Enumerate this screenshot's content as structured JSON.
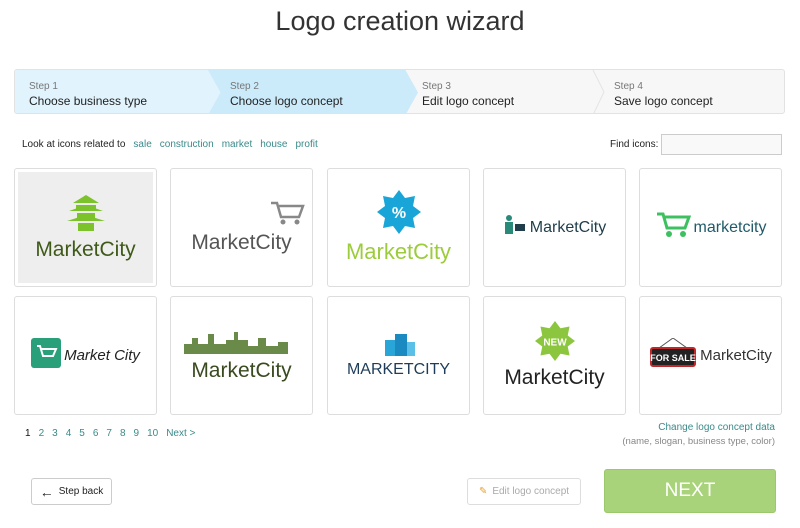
{
  "title": "Logo creation wizard",
  "steps": [
    {
      "num": "Step 1",
      "label": "Choose business type"
    },
    {
      "num": "Step 2",
      "label": "Choose logo concept"
    },
    {
      "num": "Step 3",
      "label": "Edit logo concept"
    },
    {
      "num": "Step 4",
      "label": "Save logo concept"
    }
  ],
  "related": {
    "label": "Look at icons related to",
    "tags": [
      "sale",
      "construction",
      "market",
      "house",
      "profit"
    ]
  },
  "find": {
    "label": "Find icons:",
    "value": ""
  },
  "logos": [
    {
      "text": "MarketCity",
      "color": "#3f5a18",
      "icon": "pagoda-icon",
      "selected": true
    },
    {
      "text": "MarketCity",
      "color": "#555555",
      "icon": "shopping-cart-icon"
    },
    {
      "text": "MarketCity",
      "color": "#9ccc3c",
      "icon": "percent-badge-icon"
    },
    {
      "text": "MarketCity",
      "color": "#1f3d4a",
      "icon": "person-cart-icon"
    },
    {
      "text": "marketcity",
      "color": "#1f5a6a",
      "icon": "green-cart-icon"
    },
    {
      "text": "Market City",
      "color": "#222222",
      "icon": "cart-square-icon"
    },
    {
      "text": "MarketCity",
      "color": "#3a4a20",
      "icon": "city-skyline-icon"
    },
    {
      "text": "MARKETCITY",
      "color": "#1f3d5a",
      "icon": "blue-buildings-icon"
    },
    {
      "text": "MarketCity",
      "color": "#222222",
      "icon": "new-badge-icon",
      "badge": "NEW"
    },
    {
      "text": "MarketCity",
      "color": "#333333",
      "icon": "for-sale-sign-icon",
      "badge": "FOR SALE"
    }
  ],
  "pager": {
    "pages": [
      "1",
      "2",
      "3",
      "4",
      "5",
      "6",
      "7",
      "8",
      "9",
      "10"
    ],
    "current": "1",
    "next": "Next >"
  },
  "change": {
    "link": "Change logo concept data",
    "hint": "(name, slogan, business type, color)"
  },
  "buttons": {
    "back": "Step back",
    "edit": "Edit logo concept",
    "next": "NEXT"
  }
}
